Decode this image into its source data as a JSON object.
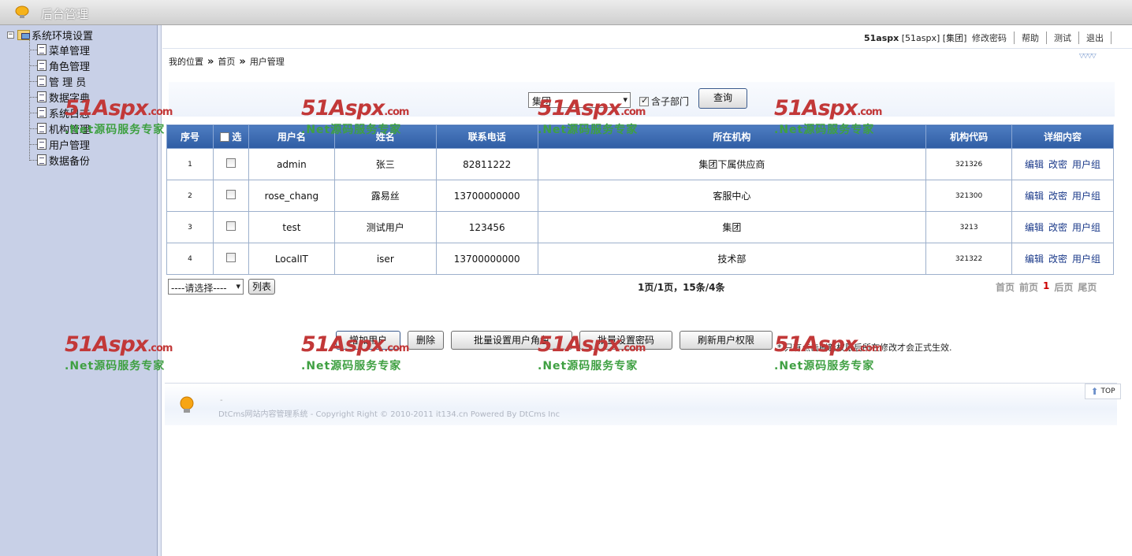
{
  "window": {
    "title": "后台管理"
  },
  "sidebar": {
    "root": "系统环境设置",
    "items": [
      {
        "label": "菜单管理"
      },
      {
        "label": "角色管理"
      },
      {
        "label": "管 理 员"
      },
      {
        "label": "数据字典"
      },
      {
        "label": "系统日志"
      },
      {
        "label": "机构管理"
      },
      {
        "label": "用户管理"
      },
      {
        "label": "数据备份"
      }
    ]
  },
  "topbar": {
    "username": "51aspx",
    "user_detail": "[51aspx] [集团]",
    "links": [
      "修改密码",
      "帮助",
      "测试",
      "退出"
    ]
  },
  "breadcrumb": {
    "prefix": "我的位置",
    "sep": "»",
    "home": "首页",
    "current": "用户管理"
  },
  "query": {
    "org_select": "集团",
    "include_sub_label": "含子部门",
    "include_sub_checked": true,
    "button": "查询"
  },
  "table": {
    "headers": [
      "序号",
      "选",
      "用户名",
      "姓名",
      "联系电话",
      "所在机构",
      "机构代码",
      "详细内容"
    ],
    "rows": [
      {
        "no": "1",
        "username": "admin",
        "name": "张三",
        "phone": "82811222",
        "org": "集团下属供应商",
        "code": "321326"
      },
      {
        "no": "2",
        "username": "rose_chang",
        "name": "露易丝",
        "phone": "13700000000",
        "org": "客服中心",
        "code": "321300"
      },
      {
        "no": "3",
        "username": "test",
        "name": "测试用户",
        "phone": "123456",
        "org": "集团",
        "code": "3213"
      },
      {
        "no": "4",
        "username": "LocalIT",
        "name": "iser",
        "phone": "13700000000",
        "org": "技术部",
        "code": "321322"
      }
    ],
    "row_actions": [
      "编辑",
      "改密",
      "用户组"
    ]
  },
  "pager": {
    "select": "----请选择----",
    "list_button": "列表",
    "info": "1页/1页，15条/4条",
    "first": "首页",
    "prev": "前页",
    "current": "1",
    "next": "后页",
    "last": "尾页"
  },
  "actions": {
    "add": "增加用户",
    "delete": "删除",
    "batch_role": "批量设置用户角色",
    "batch_pwd": "批量设置密码",
    "refresh": "刷新用户权限",
    "tip": "* 只有点击刷新权限后所在修改才会正式生效."
  },
  "footer": {
    "dash": "-",
    "copyright": "DtCms网站内容管理系统 - Copyright Right © 2010-2011 it134.cn Powered By DtCms Inc"
  },
  "top_link": "TOP",
  "watermark": {
    "brand": "51Aspx",
    "suffix": ".com",
    "slogan": ".Net源码服务专家"
  },
  "colors": {
    "header_blue": "#2f5da4",
    "sidebar": "#c8d0e7",
    "watermark_red": "#c23838",
    "watermark_green": "#3fa042"
  }
}
